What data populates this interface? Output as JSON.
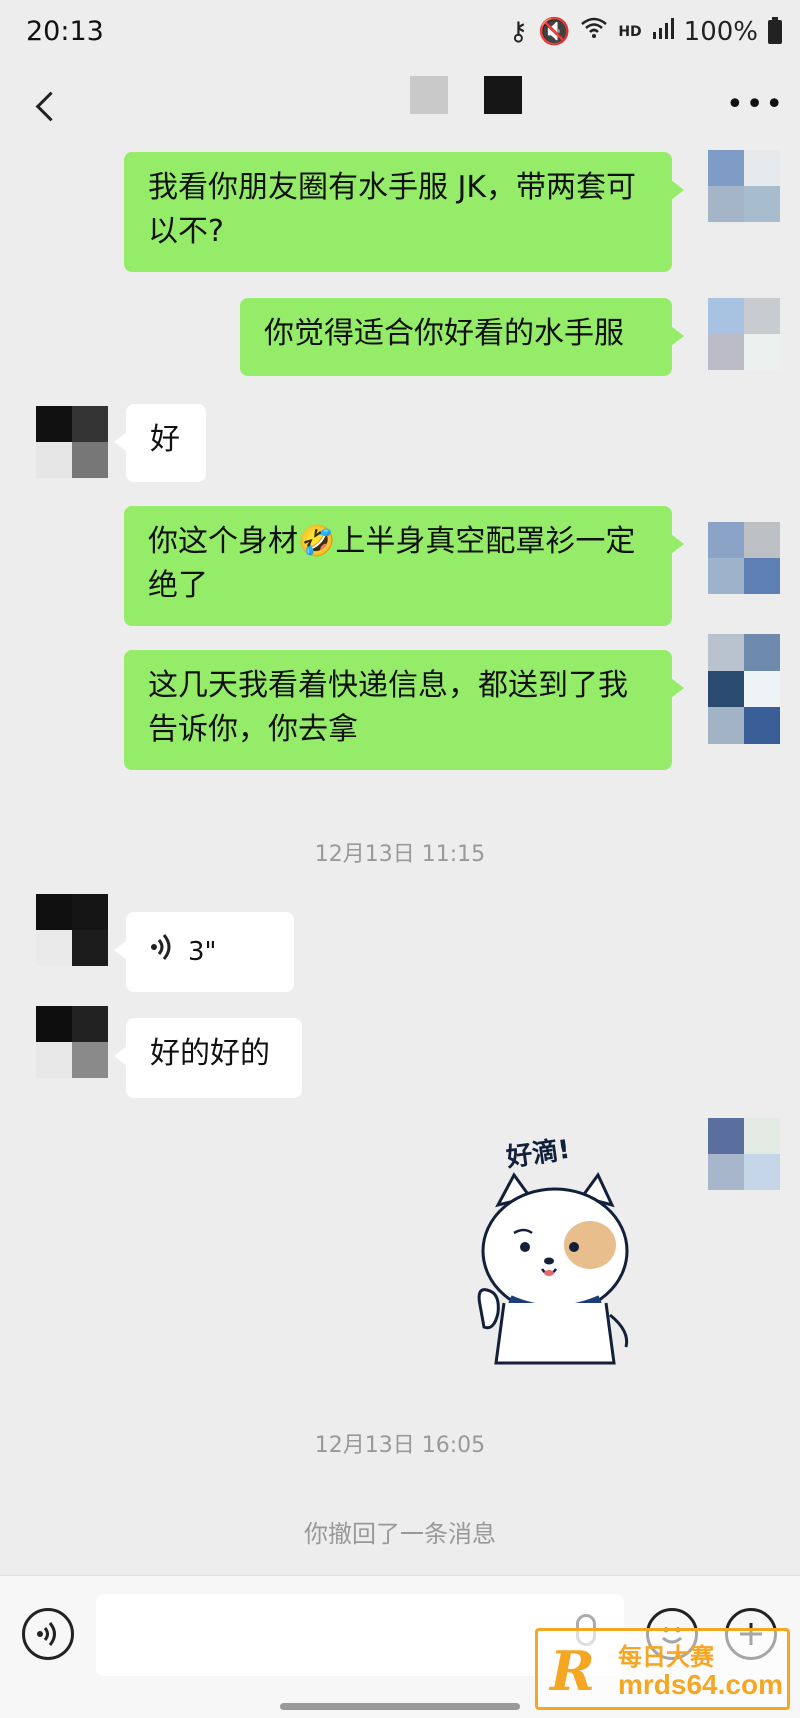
{
  "status_bar": {
    "time": "20:13",
    "hd": "HD",
    "battery": "100%"
  },
  "header": {
    "title": ""
  },
  "messages": [
    {
      "from": "me",
      "text": "我看你朋友圈有水手服 JK，带两套可以不?"
    },
    {
      "from": "me",
      "text": "你觉得适合你好看的水手服"
    },
    {
      "from": "them",
      "text": "好"
    },
    {
      "from": "me",
      "text": "你这个身材🤣上半身真空配罩衫一定绝了"
    },
    {
      "from": "me",
      "text": "这几天我看着快递信息，都送到了我告诉你，你去拿"
    },
    {
      "from": "them",
      "type": "voice",
      "duration": "3\""
    },
    {
      "from": "them",
      "text": "好的好的"
    },
    {
      "from": "me",
      "type": "sticker",
      "text": "好滴!"
    }
  ],
  "timestamps": [
    "12月13日 11:15",
    "12月13日 16:05"
  ],
  "system_notice": "你撤回了一条消息",
  "input": {
    "placeholder": ""
  },
  "watermark": {
    "logo": "R",
    "line1": "每日大赛",
    "line2": "mrds64.com"
  },
  "icons": [
    "key-icon",
    "mute-icon",
    "wifi-icon",
    "signal-icon",
    "battery-icon",
    "back-icon",
    "more-icon",
    "voice-mode-icon",
    "emoji-icon",
    "plus-icon",
    "mic-icon"
  ],
  "colors": {
    "background": "#ededed",
    "my_bubble": "#95ec69",
    "their_bubble": "#ffffff"
  }
}
